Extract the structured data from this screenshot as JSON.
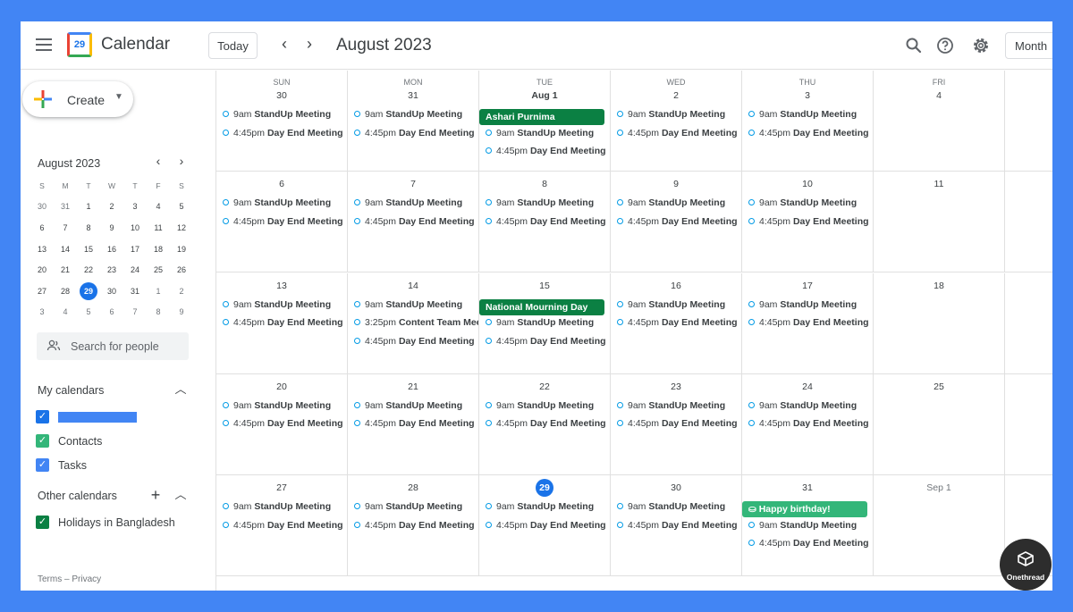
{
  "header": {
    "menu_icon": "hamburger-menu-icon",
    "logo_text": "29",
    "app_title": "Calendar",
    "today_label": "Today",
    "prev_icon": "chevron-left-icon",
    "next_icon": "chevron-right-icon",
    "month_title": "August 2023",
    "search_icon": "search-icon",
    "help_icon": "help-icon",
    "settings_icon": "gear-icon",
    "view_label": "Month"
  },
  "sidebar": {
    "create_label": "Create",
    "mini_cal": {
      "title": "August 2023",
      "weekday_headers": [
        "S",
        "M",
        "T",
        "W",
        "T",
        "F",
        "S"
      ],
      "weeks": [
        [
          "30",
          "31",
          "1",
          "2",
          "3",
          "4",
          "5"
        ],
        [
          "6",
          "7",
          "8",
          "9",
          "10",
          "11",
          "12"
        ],
        [
          "13",
          "14",
          "15",
          "16",
          "17",
          "18",
          "19"
        ],
        [
          "20",
          "21",
          "22",
          "23",
          "24",
          "25",
          "26"
        ],
        [
          "27",
          "28",
          "29",
          "30",
          "31",
          "1",
          "2"
        ],
        [
          "3",
          "4",
          "5",
          "6",
          "7",
          "8",
          "9"
        ]
      ],
      "selected": "29"
    },
    "search_people_placeholder": "Search for people",
    "my_calendars": {
      "title": "My calendars",
      "items": [
        {
          "label": "",
          "color": "#1a73e8",
          "redacted": true
        },
        {
          "label": "Contacts",
          "color": "#33b679"
        },
        {
          "label": "Tasks",
          "color": "#4285f4"
        }
      ]
    },
    "other_calendars": {
      "title": "Other calendars",
      "items": [
        {
          "label": "Holidays in Bangladesh",
          "color": "#0b8043"
        }
      ]
    },
    "terms": "Terms",
    "separator": "–",
    "privacy": "Privacy"
  },
  "grid": {
    "weekdays": [
      "SUN",
      "MON",
      "TUE",
      "WED",
      "THU",
      "FRI"
    ],
    "weeks": [
      [
        {
          "num": "30",
          "allday": [],
          "events": [
            {
              "time": "9am",
              "title": "StandUp Meeting"
            },
            {
              "time": "4:45pm",
              "title": "Day End Meeting"
            }
          ]
        },
        {
          "num": "31",
          "allday": [],
          "events": [
            {
              "time": "9am",
              "title": "StandUp Meeting"
            },
            {
              "time": "4:45pm",
              "title": "Day End Meeting"
            }
          ]
        },
        {
          "num": "Aug 1",
          "allday": [
            {
              "title": "Ashari Purnima",
              "color": "#0b8043"
            }
          ],
          "events": [
            {
              "time": "9am",
              "title": "StandUp Meeting"
            },
            {
              "time": "4:45pm",
              "title": "Day End Meeting"
            }
          ]
        },
        {
          "num": "2",
          "allday": [],
          "events": [
            {
              "time": "9am",
              "title": "StandUp Meeting"
            },
            {
              "time": "4:45pm",
              "title": "Day End Meeting"
            }
          ]
        },
        {
          "num": "3",
          "allday": [],
          "events": [
            {
              "time": "9am",
              "title": "StandUp Meeting"
            },
            {
              "time": "4:45pm",
              "title": "Day End Meeting"
            }
          ]
        },
        {
          "num": "4",
          "allday": [],
          "events": []
        }
      ],
      [
        {
          "num": "6",
          "allday": [],
          "events": [
            {
              "time": "9am",
              "title": "StandUp Meeting"
            },
            {
              "time": "4:45pm",
              "title": "Day End Meeting"
            }
          ]
        },
        {
          "num": "7",
          "allday": [],
          "events": [
            {
              "time": "9am",
              "title": "StandUp Meeting"
            },
            {
              "time": "4:45pm",
              "title": "Day End Meeting"
            }
          ]
        },
        {
          "num": "8",
          "allday": [],
          "events": [
            {
              "time": "9am",
              "title": "StandUp Meeting"
            },
            {
              "time": "4:45pm",
              "title": "Day End Meeting"
            }
          ]
        },
        {
          "num": "9",
          "allday": [],
          "events": [
            {
              "time": "9am",
              "title": "StandUp Meeting"
            },
            {
              "time": "4:45pm",
              "title": "Day End Meeting"
            }
          ]
        },
        {
          "num": "10",
          "allday": [],
          "events": [
            {
              "time": "9am",
              "title": "StandUp Meeting"
            },
            {
              "time": "4:45pm",
              "title": "Day End Meeting"
            }
          ]
        },
        {
          "num": "11",
          "allday": [],
          "events": []
        }
      ],
      [
        {
          "num": "13",
          "allday": [],
          "events": [
            {
              "time": "9am",
              "title": "StandUp Meeting"
            },
            {
              "time": "4:45pm",
              "title": "Day End Meeting"
            }
          ]
        },
        {
          "num": "14",
          "allday": [],
          "events": [
            {
              "time": "9am",
              "title": "StandUp Meeting"
            },
            {
              "time": "3:25pm",
              "title": "Content Team Mee"
            },
            {
              "time": "4:45pm",
              "title": "Day End Meeting"
            }
          ]
        },
        {
          "num": "15",
          "allday": [
            {
              "title": "National Mourning Day",
              "color": "#0b8043"
            }
          ],
          "events": [
            {
              "time": "9am",
              "title": "StandUp Meeting"
            },
            {
              "time": "4:45pm",
              "title": "Day End Meeting"
            }
          ]
        },
        {
          "num": "16",
          "allday": [],
          "events": [
            {
              "time": "9am",
              "title": "StandUp Meeting"
            },
            {
              "time": "4:45pm",
              "title": "Day End Meeting"
            }
          ]
        },
        {
          "num": "17",
          "allday": [],
          "events": [
            {
              "time": "9am",
              "title": "StandUp Meeting"
            },
            {
              "time": "4:45pm",
              "title": "Day End Meeting"
            }
          ]
        },
        {
          "num": "18",
          "allday": [],
          "events": []
        }
      ],
      [
        {
          "num": "20",
          "allday": [],
          "events": [
            {
              "time": "9am",
              "title": "StandUp Meeting"
            },
            {
              "time": "4:45pm",
              "title": "Day End Meeting"
            }
          ]
        },
        {
          "num": "21",
          "allday": [],
          "events": [
            {
              "time": "9am",
              "title": "StandUp Meeting"
            },
            {
              "time": "4:45pm",
              "title": "Day End Meeting"
            }
          ]
        },
        {
          "num": "22",
          "allday": [],
          "events": [
            {
              "time": "9am",
              "title": "StandUp Meeting"
            },
            {
              "time": "4:45pm",
              "title": "Day End Meeting"
            }
          ]
        },
        {
          "num": "23",
          "allday": [],
          "events": [
            {
              "time": "9am",
              "title": "StandUp Meeting"
            },
            {
              "time": "4:45pm",
              "title": "Day End Meeting"
            }
          ]
        },
        {
          "num": "24",
          "allday": [],
          "events": [
            {
              "time": "9am",
              "title": "StandUp Meeting"
            },
            {
              "time": "4:45pm",
              "title": "Day End Meeting"
            }
          ]
        },
        {
          "num": "25",
          "allday": [],
          "events": []
        }
      ],
      [
        {
          "num": "27",
          "allday": [],
          "events": [
            {
              "time": "9am",
              "title": "StandUp Meeting"
            },
            {
              "time": "4:45pm",
              "title": "Day End Meeting"
            }
          ]
        },
        {
          "num": "28",
          "allday": [],
          "events": [
            {
              "time": "9am",
              "title": "StandUp Meeting"
            },
            {
              "time": "4:45pm",
              "title": "Day End Meeting"
            }
          ]
        },
        {
          "num": "29",
          "today": true,
          "allday": [],
          "events": [
            {
              "time": "9am",
              "title": "StandUp Meeting"
            },
            {
              "time": "4:45pm",
              "title": "Day End Meeting"
            }
          ]
        },
        {
          "num": "30",
          "allday": [],
          "events": [
            {
              "time": "9am",
              "title": "StandUp Meeting"
            },
            {
              "time": "4:45pm",
              "title": "Day End Meeting"
            }
          ]
        },
        {
          "num": "31",
          "allday": [
            {
              "title": "Happy birthday!",
              "color": "#33b679",
              "icon": "cake-icon"
            }
          ],
          "events": [
            {
              "time": "9am",
              "title": "StandUp Meeting"
            },
            {
              "time": "4:45pm",
              "title": "Day End Meeting"
            }
          ]
        },
        {
          "num": "Sep 1",
          "muted": true,
          "allday": [],
          "events": []
        }
      ]
    ]
  },
  "brand": {
    "name": "Onethread",
    "icon": "onethread-logo-icon"
  },
  "colors": {
    "accent": "#1a73e8",
    "frame": "#4285f4",
    "holiday": "#0b8043",
    "birthday": "#33b679",
    "event_dot": "#039be5"
  }
}
